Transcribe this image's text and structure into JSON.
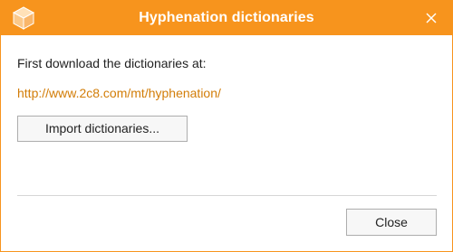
{
  "window": {
    "title": "Hyphenation dictionaries",
    "accent_color": "#f7941d",
    "app_icon": "cube-icon",
    "close_icon": "close-icon"
  },
  "content": {
    "instruction": "First download the dictionaries at:",
    "link_text": "http://www.2c8.com/mt/hyphenation/",
    "link_color": "#d27d08",
    "import_button_label": "Import dictionaries..."
  },
  "footer": {
    "close_button_label": "Close"
  }
}
